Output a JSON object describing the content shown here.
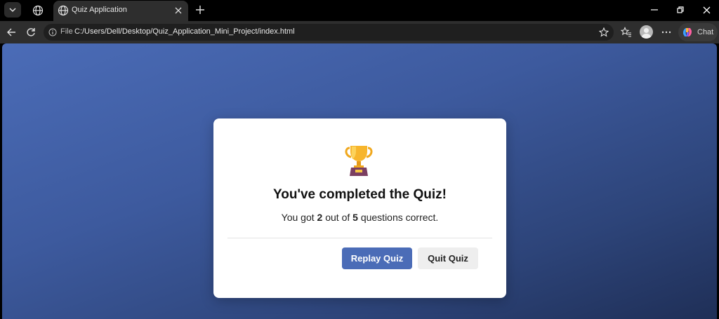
{
  "browser": {
    "tab_title": "Quiz Application",
    "address_prefix": "File",
    "url": "C:/Users/Dell/Desktop/Quiz_Application_Mini_Project/index.html",
    "chat_label": "Chat"
  },
  "icons": {
    "tab_menu": "chevron-down-icon",
    "tab_globe": "globe-icon",
    "new_tab": "plus-icon",
    "back": "arrow-left-icon",
    "reload": "reload-icon",
    "site_info": "info-icon",
    "favorite": "star-icon",
    "favorites": "favorites-icon",
    "more": "more-icon",
    "trophy": "trophy-icon"
  },
  "quiz": {
    "title": "You've completed the Quiz!",
    "result_prefix": "You got",
    "score": "2",
    "result_middle": "out of",
    "total": "5",
    "result_suffix": "questions correct.",
    "replay_label": "Replay Quiz",
    "quit_label": "Quit Quiz"
  },
  "colors": {
    "accent": "#4b6cb7",
    "background_gradient_start": "#4b6cb7",
    "background_gradient_end": "#1f2f57"
  }
}
